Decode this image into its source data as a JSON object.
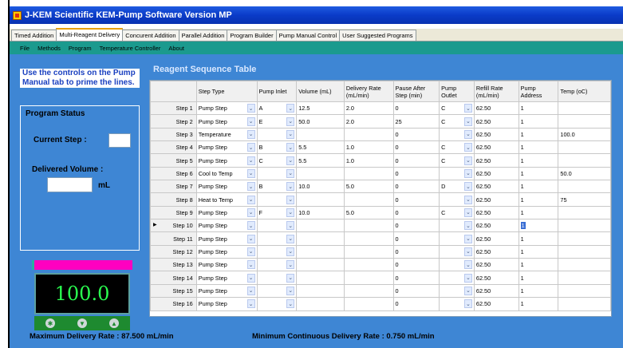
{
  "window": {
    "title": "J-KEM Scientific KEM-Pump Software   Version MP"
  },
  "tabs": [
    {
      "label": "Timed Addition"
    },
    {
      "label": "Multi-Reagent Delivery"
    },
    {
      "label": "Concurent Addition"
    },
    {
      "label": "Parallel Addition"
    },
    {
      "label": "Program Builder"
    },
    {
      "label": "Pump Manual Control"
    },
    {
      "label": "User Suggested Programs"
    }
  ],
  "active_tab": "Multi-Reagent Delivery",
  "menu": [
    {
      "label": "File"
    },
    {
      "label": "Methods"
    },
    {
      "label": "Program"
    },
    {
      "label": "Temperature Controller"
    },
    {
      "label": "About"
    }
  ],
  "instructions": "Use the controls on the Pump Manual tab to prime the lines.",
  "program_status": {
    "title": "Program Status",
    "current_step_label": "Current Step :",
    "current_step_value": "",
    "delivered_label": "Delivered Volume :",
    "delivered_value": "",
    "unit": "mL"
  },
  "pump_display": {
    "value": "100.0",
    "buttons": [
      "✱",
      "▼",
      "▲"
    ]
  },
  "table": {
    "title": "Reagent Sequence Table",
    "columns": [
      "Step Type",
      "Pump Inlet",
      "Volume (mL)",
      "Delivery Rate (mL/min)",
      "Pause After Step (min)",
      "Pump Outlet",
      "Refill Rate (mL/min)",
      "Pump Address",
      "Temp (oC)"
    ],
    "current_row": 9,
    "rows": [
      {
        "step": "Step 1",
        "type": "Pump Step",
        "inlet": "A",
        "volume": "12.5",
        "rate": "2.0",
        "pause": "0",
        "outlet": "C",
        "refill": "62.50",
        "address": "1",
        "temp": ""
      },
      {
        "step": "Step 2",
        "type": "Pump Step",
        "inlet": "E",
        "volume": "50.0",
        "rate": "2.0",
        "pause": "25",
        "outlet": "C",
        "refill": "62.50",
        "address": "1",
        "temp": ""
      },
      {
        "step": "Step 3",
        "type": "Temperature",
        "inlet": "",
        "volume": "",
        "rate": "",
        "pause": "0",
        "outlet": "",
        "refill": "62.50",
        "address": "1",
        "temp": "100.0"
      },
      {
        "step": "Step 4",
        "type": "Pump Step",
        "inlet": "B",
        "volume": "5.5",
        "rate": "1.0",
        "pause": "0",
        "outlet": "C",
        "refill": "62.50",
        "address": "1",
        "temp": ""
      },
      {
        "step": "Step 5",
        "type": "Pump Step",
        "inlet": "C",
        "volume": "5.5",
        "rate": "1.0",
        "pause": "0",
        "outlet": "C",
        "refill": "62.50",
        "address": "1",
        "temp": ""
      },
      {
        "step": "Step 6",
        "type": "Cool to Temp",
        "inlet": "",
        "volume": "",
        "rate": "",
        "pause": "0",
        "outlet": "",
        "refill": "62.50",
        "address": "1",
        "temp": "50.0"
      },
      {
        "step": "Step 7",
        "type": "Pump Step",
        "inlet": "B",
        "volume": "10.0",
        "rate": "5.0",
        "pause": "0",
        "outlet": "D",
        "refill": "62.50",
        "address": "1",
        "temp": ""
      },
      {
        "step": "Step 8",
        "type": "Heat to Temp",
        "inlet": "",
        "volume": "",
        "rate": "",
        "pause": "0",
        "outlet": "",
        "refill": "62.50",
        "address": "1",
        "temp": "75"
      },
      {
        "step": "Step 9",
        "type": "Pump Step",
        "inlet": "F",
        "volume": "10.0",
        "rate": "5.0",
        "pause": "0",
        "outlet": "C",
        "refill": "62.50",
        "address": "1",
        "temp": ""
      },
      {
        "step": "Step 10",
        "type": "Pump Step",
        "inlet": "",
        "volume": "",
        "rate": "",
        "pause": "0",
        "outlet": "",
        "refill": "62.50",
        "address": "1",
        "temp": ""
      },
      {
        "step": "Step 11",
        "type": "Pump Step",
        "inlet": "",
        "volume": "",
        "rate": "",
        "pause": "0",
        "outlet": "",
        "refill": "62.50",
        "address": "1",
        "temp": ""
      },
      {
        "step": "Step 12",
        "type": "Pump Step",
        "inlet": "",
        "volume": "",
        "rate": "",
        "pause": "0",
        "outlet": "",
        "refill": "62.50",
        "address": "1",
        "temp": ""
      },
      {
        "step": "Step 13",
        "type": "Pump Step",
        "inlet": "",
        "volume": "",
        "rate": "",
        "pause": "0",
        "outlet": "",
        "refill": "62.50",
        "address": "1",
        "temp": ""
      },
      {
        "step": "Step 14",
        "type": "Pump Step",
        "inlet": "",
        "volume": "",
        "rate": "",
        "pause": "0",
        "outlet": "",
        "refill": "62.50",
        "address": "1",
        "temp": ""
      },
      {
        "step": "Step 15",
        "type": "Pump Step",
        "inlet": "",
        "volume": "",
        "rate": "",
        "pause": "0",
        "outlet": "",
        "refill": "62.50",
        "address": "1",
        "temp": ""
      },
      {
        "step": "Step 16",
        "type": "Pump Step",
        "inlet": "",
        "volume": "",
        "rate": "",
        "pause": "0",
        "outlet": "",
        "refill": "62.50",
        "address": "1",
        "temp": ""
      }
    ]
  },
  "footer": {
    "max_rate": "Maximum Delivery Rate : 87.500 mL/min",
    "min_rate": "Minimum Continuous Delivery Rate : 0.750 mL/min"
  },
  "colors": {
    "titlebar": "#0a3bc8",
    "menubar": "#1b9a8e",
    "panel": "#3e86d4",
    "display_text": "#2aff50"
  }
}
